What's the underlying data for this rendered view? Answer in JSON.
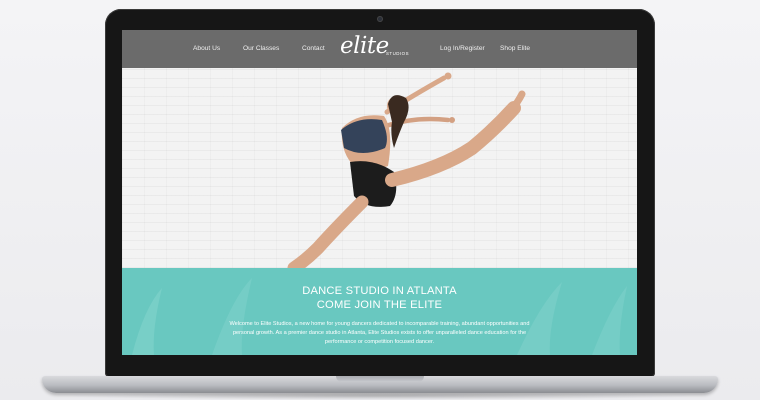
{
  "nav": {
    "about": "About Us",
    "classes": "Our Classes",
    "contact": "Contact",
    "login": "Log In/Register",
    "shop": "Shop Elite"
  },
  "logo": {
    "script": "elite",
    "studios": "STUDIOS"
  },
  "band": {
    "headline_1": "DANCE STUDIO IN ATLANTA",
    "headline_2": "COME JOIN THE ELITE",
    "body": "Welcome to Elite Studios, a new home for young dancers dedicated to incomparable training, abundant opportunities and personal growth. As a premier dance studio in Atlanta, Elite Studios exists to offer unparalleled dance education for the performance or competition focused dancer."
  },
  "colors": {
    "nav_bg": "#6b6b6b",
    "teal": "#69c8c0"
  }
}
